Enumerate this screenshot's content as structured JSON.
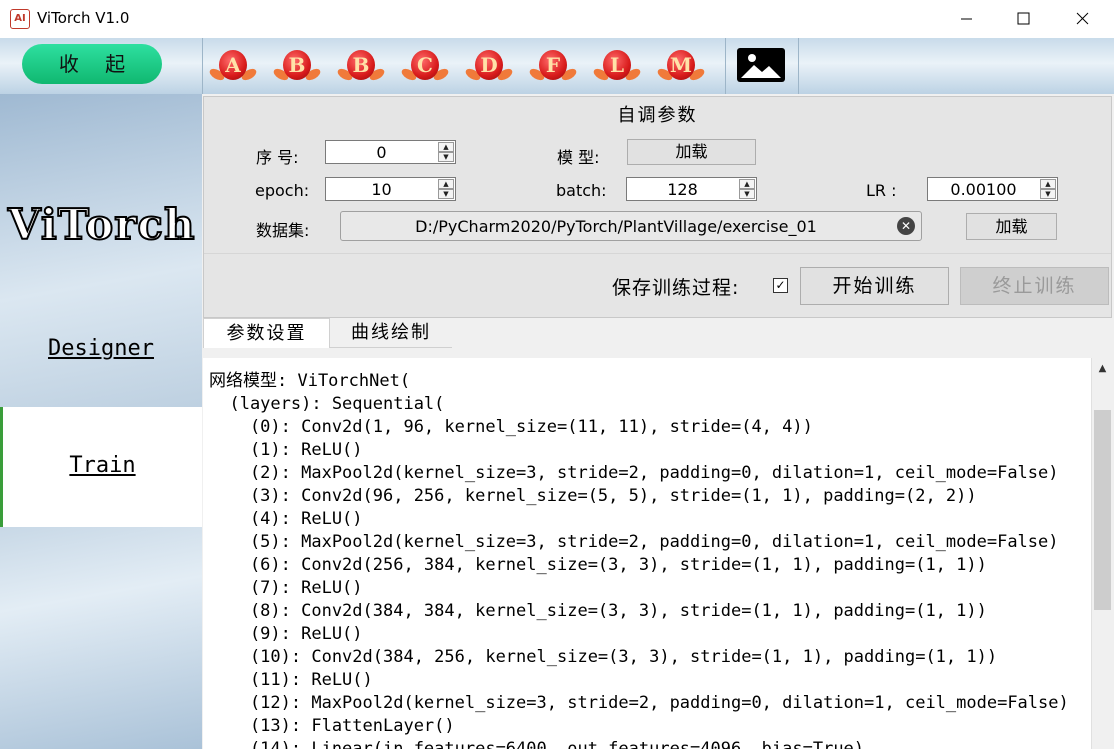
{
  "window": {
    "title": "ViTorch V1.0",
    "app_icon_text": "AI"
  },
  "toolbar": {
    "collapse_label": "收 起",
    "letters": [
      "A",
      "B",
      "B",
      "C",
      "D",
      "F",
      "L",
      "M"
    ],
    "letter_colors": {
      "ball": "#d81b1b",
      "leaf": "#f07a3a"
    },
    "image_icon": "image-icon"
  },
  "sidebar": {
    "brand": "ViTorch",
    "items": [
      {
        "label": "Designer"
      },
      {
        "label": "Train"
      }
    ],
    "active_color": "#3a9d3a"
  },
  "panel": {
    "title": "自调参数",
    "index_label": "序 号:",
    "index_value": "0",
    "model_label": "模 型:",
    "model_load": "加载",
    "epoch_label": "epoch:",
    "epoch_value": "10",
    "batch_label": "batch:",
    "batch_value": "128",
    "lr_label": "LR :",
    "lr_value": "0.00100",
    "dataset_label": "数据集:",
    "dataset_value": "D:/PyCharm2020/PyTorch/PlantVillage/exercise_01",
    "dataset_load": "加载",
    "save_label": "保存训练过程:",
    "save_checked": true,
    "start_label": "开始训练",
    "stop_label": "终止训练"
  },
  "tabs": [
    {
      "label": "参数设置"
    },
    {
      "label": "曲线绘制"
    }
  ],
  "output": {
    "lines": [
      "网络模型: ViTorchNet(",
      "  (layers): Sequential(",
      "    (0): Conv2d(1, 96, kernel_size=(11, 11), stride=(4, 4))",
      "    (1): ReLU()",
      "    (2): MaxPool2d(kernel_size=3, stride=2, padding=0, dilation=1, ceil_mode=False)",
      "    (3): Conv2d(96, 256, kernel_size=(5, 5), stride=(1, 1), padding=(2, 2))",
      "    (4): ReLU()",
      "    (5): MaxPool2d(kernel_size=3, stride=2, padding=0, dilation=1, ceil_mode=False)",
      "    (6): Conv2d(256, 384, kernel_size=(3, 3), stride=(1, 1), padding=(1, 1))",
      "    (7): ReLU()",
      "    (8): Conv2d(384, 384, kernel_size=(3, 3), stride=(1, 1), padding=(1, 1))",
      "    (9): ReLU()",
      "    (10): Conv2d(384, 256, kernel_size=(3, 3), stride=(1, 1), padding=(1, 1))",
      "    (11): ReLU()",
      "    (12): MaxPool2d(kernel_size=3, stride=2, padding=0, dilation=1, ceil_mode=False)",
      "    (13): FlattenLayer()",
      "    (14): Linear(in_features=6400, out_features=4096, bias=True)"
    ]
  }
}
